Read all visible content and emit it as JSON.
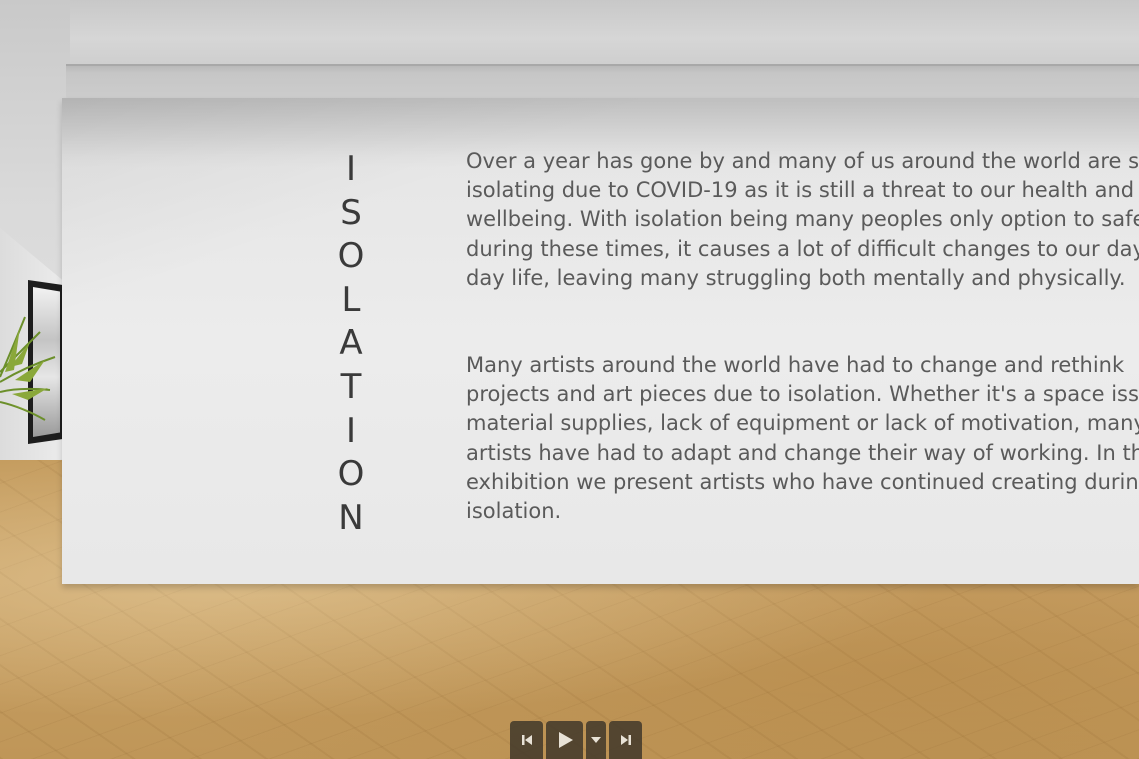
{
  "exhibit": {
    "title_letters": [
      "I",
      "S",
      "O",
      "L",
      "A",
      "T",
      "I",
      "O",
      "N"
    ],
    "paragraph1": [
      "Over a year has gone by and many of us around the world are sti",
      "isolating due to COVID-19 as it is still a threat to our health and",
      "wellbeing. With isolation being many peoples only option to safe",
      "during these times, it causes a lot of difficult changes to our day-",
      "day life, leaving many struggling both mentally and physically."
    ],
    "paragraph2": [
      "Many artists around the world have had to change and rethink",
      "projects and art pieces due to isolation. Whether it's a space issu",
      "material supplies, lack of equipment or lack of motivation, many",
      "artists have had to adapt and change their way of working. In thi",
      "exhibition we present artists who have continued creating durin",
      "isolation."
    ]
  },
  "controls": {
    "buttons": [
      "skip-back-icon",
      "play-icon",
      "caret-down-icon",
      "skip-forward-icon"
    ]
  },
  "colors": {
    "title_text": "#3a3a3a",
    "body_text": "#5a5a5a",
    "wall": "#ececec",
    "floor": "#c39a5c",
    "control_bg": "#3c3428",
    "control_icon": "#e8e2d6"
  }
}
